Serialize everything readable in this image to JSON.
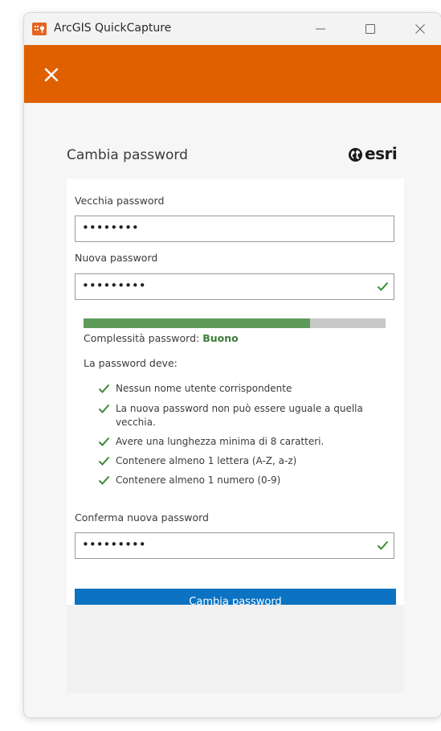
{
  "window": {
    "title": "ArcGIS QuickCapture"
  },
  "form": {
    "title": "Cambia password",
    "logo_text": "esri",
    "old_password": {
      "label": "Vecchia password",
      "value": "••••••••"
    },
    "new_password": {
      "label": "Nuova password",
      "value": "•••••••••"
    },
    "strength": {
      "label": "Complessità password:",
      "value": "Buono",
      "level": 0.75
    },
    "rules_title": "La password deve:",
    "rules": [
      "Nessun nome utente corrispondente",
      "La nuova password non può essere uguale a quella vecchia.",
      "Avere una lunghezza minima di 8 caratteri.",
      "Contenere almeno 1 lettera (A-Z, a-z)",
      "Contenere almeno 1 numero (0-9)"
    ],
    "confirm_password": {
      "label": "Conferma nuova password",
      "value": "•••••••••"
    },
    "submit_label": "Cambia password"
  },
  "colors": {
    "accent_orange": "#e06000",
    "submit_blue": "#0b73c2",
    "strength_green": "#5e9a5a",
    "check_green": "#3d8a3a"
  }
}
